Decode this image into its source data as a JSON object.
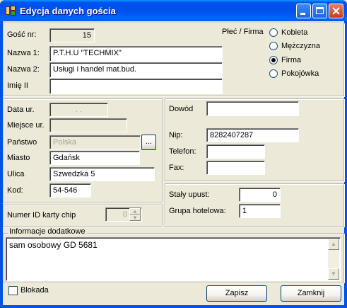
{
  "window": {
    "title": "Edycja danych gościa"
  },
  "guest": {
    "nr_label": "Gość nr:",
    "nr_value": "15",
    "name1_label": "Nazwa 1:",
    "name1_value": "P.T.H.U \"TECHMIX\"",
    "name2_label": "Nazwa 2:",
    "name2_value": "Usługi  i  handel mat.bud.",
    "firstname_label": "Imię II",
    "firstname_value": ""
  },
  "type_group": {
    "label": "Płeć / Firma",
    "options": [
      {
        "label": "Kobieta",
        "selected": false
      },
      {
        "label": "Mężczyzna",
        "selected": false
      },
      {
        "label": "Firma",
        "selected": true
      },
      {
        "label": "Pokojówka",
        "selected": false
      }
    ]
  },
  "address": {
    "birthdate_label": "Data ur.",
    "birthdate_value": " . .",
    "birthplace_label": "Miejsce ur.",
    "birthplace_value": "",
    "country_label": "Państwo",
    "country_value": "Polska",
    "country_button": "...",
    "city_label": "Miasto",
    "city_value": "Gdańsk",
    "street_label": "Ulica",
    "street_value": "Szwedzka 5",
    "postcode_label": "Kod:",
    "postcode_value": "54-546"
  },
  "ids": {
    "document_label": "Dowód",
    "document_value": "",
    "nip_label": "Nip:",
    "nip_value": "8282407287",
    "phone_label": "Telefon:",
    "phone_value": "",
    "fax_label": "Fax:",
    "fax_value": ""
  },
  "chip": {
    "label": "Numer ID karty chip",
    "value": "0"
  },
  "discount": {
    "discount_label": "Stały upust:",
    "discount_value": "0",
    "group_label": "Grupa hotelowa:",
    "group_value": "1"
  },
  "info": {
    "label": "Informacje dodatkowe",
    "value": "sam osobowy GD 5681"
  },
  "footer": {
    "blocked_label": "Blokada",
    "save_label": "Zapisz",
    "close_label": "Zamknij"
  },
  "colors": {
    "titlebar": "#0054e3",
    "face": "#ece9d8",
    "close": "#c8391a"
  }
}
